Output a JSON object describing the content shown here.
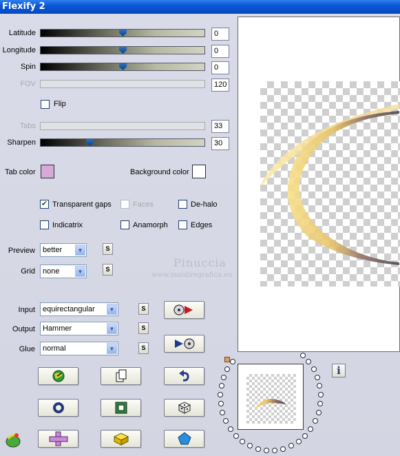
{
  "window": {
    "title": "Flexify 2"
  },
  "sliders": {
    "latitude": {
      "label": "Latitude",
      "value": "0",
      "level": 0.5
    },
    "longitude": {
      "label": "Longitude",
      "value": "0",
      "level": 0.5
    },
    "spin": {
      "label": "Spin",
      "value": "0",
      "level": 0.5
    },
    "fov": {
      "label": "FOV",
      "value": "120",
      "level": null,
      "disabled": true
    },
    "tabs": {
      "label": "Tabs",
      "value": "33",
      "level": null,
      "disabled": true
    },
    "sharpen": {
      "label": "Sharpen",
      "value": "30",
      "level": 0.3
    }
  },
  "flip": {
    "label": "Flip",
    "checked": false
  },
  "colors": {
    "tab_color_label": "Tab color",
    "tab_color": "#d8a8d8",
    "background_color_label": "Background color",
    "background_color": "#ffffff"
  },
  "options": {
    "transparent_gaps": {
      "label": "Transparent gaps",
      "checked": true
    },
    "faces": {
      "label": "Faces",
      "checked": false,
      "disabled": true
    },
    "de_halo": {
      "label": "De-halo",
      "checked": false
    },
    "indicatrix": {
      "label": "Indicatrix",
      "checked": false
    },
    "anamorph": {
      "label": "Anamorph",
      "checked": false
    },
    "edges": {
      "label": "Edges",
      "checked": false
    }
  },
  "preview": {
    "label": "Preview",
    "value": "better",
    "s_label": "S"
  },
  "grid": {
    "label": "Grid",
    "value": "none",
    "s_label": "S"
  },
  "input": {
    "label": "Input",
    "value": "equirectangular",
    "s_label": "S"
  },
  "output": {
    "label": "Output",
    "value": "Hammer",
    "s_label": "S"
  },
  "glue": {
    "label": "Glue",
    "value": "normal",
    "s_label": "S"
  },
  "watermark": {
    "name": "Pinuccia",
    "site": "www.maidiregrafica.eu"
  },
  "icons": {
    "open_preset": "disk-load-icon",
    "save_preset": "disk-save-icon",
    "randomize_globe": "globe-icon",
    "copy": "copy-pages-icon",
    "undo": "undo-arrow-icon",
    "ring": "ring-icon",
    "frame": "frame-icon",
    "dice": "dice-icon",
    "cross": "cross-icon",
    "cube": "cube-icon",
    "pentagon": "pentagon-icon",
    "info": "info-icon",
    "logo": "flexify-logo-icon"
  },
  "info_label": "i"
}
